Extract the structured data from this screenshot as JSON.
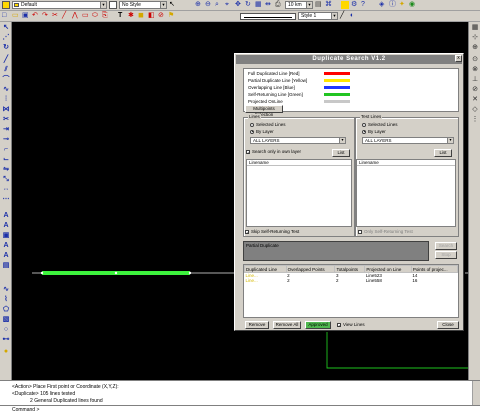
{
  "toolbar": {
    "layer_value": "Default",
    "style_value": "No Style",
    "scale_value": "10 km",
    "linestyle_value": "Style 1"
  },
  "dialog": {
    "title": "Duplicate Search V1.2",
    "close_label": "x",
    "legend": [
      {
        "label": "Full Duplicated Line [Red]",
        "color": "#ff0000"
      },
      {
        "label": "Partial Duplicate Line [Yellow]",
        "color": "#ffe600"
      },
      {
        "label": "Overlapping Line [Blue]",
        "color": "#1f35ff"
      },
      {
        "label": "Self-Returning Line [Green]",
        "color": "#22c422"
      },
      {
        "label": "Projected OnLine",
        "color": "#c8c8c8"
      }
    ],
    "tab_label": "Multipoints Selection",
    "lines_group": {
      "label": "Lines",
      "radio_selected_lines": "Selected Lines",
      "radio_by_layer": "By Layer",
      "layer_dropdown": "ALL LAYERS",
      "search_only_own_layer": "Search only in own layer",
      "list_button": "List",
      "list_header": "Linename"
    },
    "test_lines_group": {
      "label": "Test Lines",
      "radio_selected_lines": "Selected Lines",
      "radio_by_layer": "By Layer",
      "layer_dropdown": "ALL LAYERS",
      "list_button": "List",
      "list_header": "Linename"
    },
    "skip_self_returning": "Skip Self-Returning Test",
    "only_self_returning": "Only Self-Returning Test",
    "partial_duplicate_label": "Partial Duplicate",
    "search_button": "Search",
    "stop_button": "Stop",
    "results": {
      "columns": [
        "Duplicated Line",
        "Overlapped Points",
        "Totalpoints",
        "Projected on Line",
        "Points of projec..."
      ],
      "rows": [
        {
          "line": "Line...",
          "overlapped": "2",
          "total": "3",
          "projected": "Line523",
          "points": "14"
        },
        {
          "line": "Line...",
          "overlapped": "2",
          "total": "2",
          "projected": "Line558",
          "points": "16"
        }
      ]
    },
    "remove_button": "Remove",
    "remove_all_button": "Remove All",
    "approved_button": "Approved",
    "view_lines_label": "View Lines",
    "close_button": "Close"
  },
  "command": {
    "lines": [
      "<Action> Place First point or Coordinate (X,Y,Z):",
      "<Duplicate> 105 lines tested",
      "             2 General Duplicated lines found"
    ],
    "prompt": "Command >"
  }
}
